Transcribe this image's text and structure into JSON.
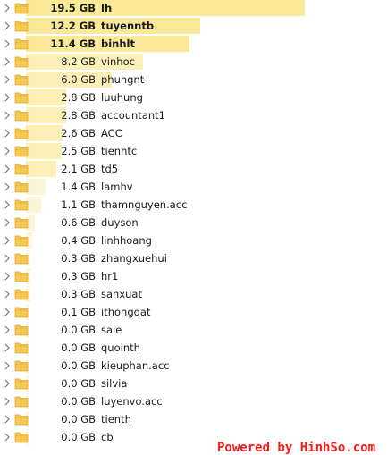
{
  "folders": [
    {
      "size": "19.5 GB",
      "name": "lh",
      "fraction": 1.0,
      "bold": true
    },
    {
      "size": "12.2 GB",
      "name": "tuyenntb",
      "fraction": 0.626,
      "bold": true
    },
    {
      "size": "11.4 GB",
      "name": "binhlt",
      "fraction": 0.585,
      "bold": true
    },
    {
      "size": "8.2 GB",
      "name": "vinhoc",
      "fraction": 0.421,
      "bold": false
    },
    {
      "size": "6.0 GB",
      "name": "phungnt",
      "fraction": 0.308,
      "bold": false
    },
    {
      "size": "2.8 GB",
      "name": "luuhung",
      "fraction": 0.144,
      "bold": false
    },
    {
      "size": "2.8 GB",
      "name": "accountant1",
      "fraction": 0.144,
      "bold": false
    },
    {
      "size": "2.6 GB",
      "name": "ACC",
      "fraction": 0.133,
      "bold": false
    },
    {
      "size": "2.5 GB",
      "name": "tienntc",
      "fraction": 0.128,
      "bold": false
    },
    {
      "size": "2.1 GB",
      "name": "td5",
      "fraction": 0.108,
      "bold": false
    },
    {
      "size": "1.4 GB",
      "name": "lamhv",
      "fraction": 0.072,
      "bold": false
    },
    {
      "size": "1.1 GB",
      "name": "thamnguyen.acc",
      "fraction": 0.056,
      "bold": false
    },
    {
      "size": "0.6 GB",
      "name": "duyson",
      "fraction": 0.031,
      "bold": false
    },
    {
      "size": "0.4 GB",
      "name": "linhhoang",
      "fraction": 0.021,
      "bold": false
    },
    {
      "size": "0.3 GB",
      "name": "zhangxuehui",
      "fraction": 0.015,
      "bold": false
    },
    {
      "size": "0.3 GB",
      "name": "hr1",
      "fraction": 0.015,
      "bold": false
    },
    {
      "size": "0.3 GB",
      "name": "sanxuat",
      "fraction": 0.015,
      "bold": false
    },
    {
      "size": "0.1 GB",
      "name": "ithongdat",
      "fraction": 0.005,
      "bold": false
    },
    {
      "size": "0.0 GB",
      "name": "sale",
      "fraction": 0.0,
      "bold": false
    },
    {
      "size": "0.0 GB",
      "name": "quointh",
      "fraction": 0.0,
      "bold": false
    },
    {
      "size": "0.0 GB",
      "name": "kieuphan.acc",
      "fraction": 0.0,
      "bold": false
    },
    {
      "size": "0.0 GB",
      "name": "silvia",
      "fraction": 0.0,
      "bold": false
    },
    {
      "size": "0.0 GB",
      "name": "luyenvo.acc",
      "fraction": 0.0,
      "bold": false
    },
    {
      "size": "0.0 GB",
      "name": "tienth",
      "fraction": 0.0,
      "bold": false
    },
    {
      "size": "0.0 GB",
      "name": "cb",
      "fraction": 0.0,
      "bold": false
    }
  ],
  "footer": {
    "text": "Powered by HinhSo.com"
  },
  "colors": {
    "bar_strong": "#fbe99a",
    "bar_mid": "#fcefb8",
    "bar_light": "#fdf5d8",
    "folder_body": "#f6c94f",
    "folder_edge": "#dca936",
    "chevron": "#7a7a7a",
    "footer_text": "#ff1a1a"
  },
  "icons": {
    "expand": "chevron-right-icon",
    "folder": "folder-icon"
  }
}
